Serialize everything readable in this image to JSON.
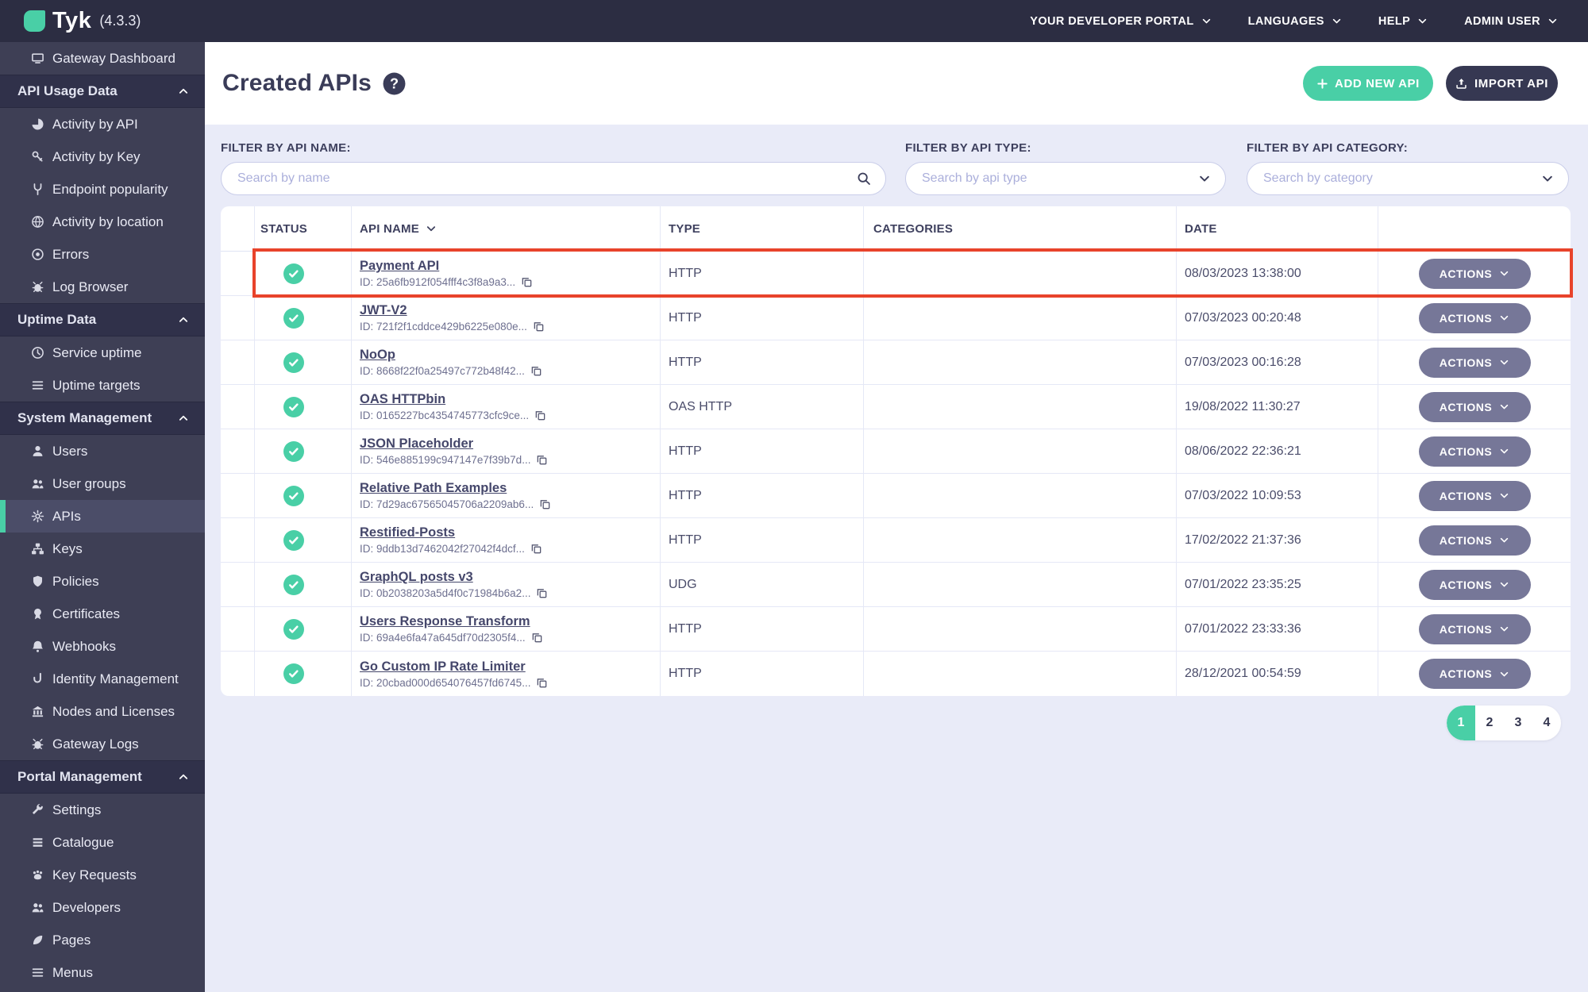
{
  "topbar": {
    "brand": "Tyk",
    "version": "(4.3.3)",
    "menu": [
      {
        "label": "YOUR DEVELOPER PORTAL"
      },
      {
        "label": "LANGUAGES"
      },
      {
        "label": "HELP"
      },
      {
        "label": "ADMIN USER"
      }
    ]
  },
  "sidebar": {
    "items": [
      {
        "type": "item",
        "icon": "monitor",
        "label": "Gateway Dashboard"
      },
      {
        "type": "section",
        "label": "API Usage Data"
      },
      {
        "type": "item",
        "icon": "chart-pie",
        "label": "Activity by API"
      },
      {
        "type": "item",
        "icon": "key",
        "label": "Activity by Key"
      },
      {
        "type": "item",
        "icon": "fork",
        "label": "Endpoint popularity"
      },
      {
        "type": "item",
        "icon": "globe",
        "label": "Activity by location"
      },
      {
        "type": "item",
        "icon": "target",
        "label": "Errors"
      },
      {
        "type": "item",
        "icon": "bug",
        "label": "Log Browser"
      },
      {
        "type": "section",
        "label": "Uptime Data"
      },
      {
        "type": "item",
        "icon": "clock",
        "label": "Service uptime"
      },
      {
        "type": "item",
        "icon": "list",
        "label": "Uptime targets"
      },
      {
        "type": "section",
        "label": "System Management"
      },
      {
        "type": "item",
        "icon": "user",
        "label": "Users"
      },
      {
        "type": "item",
        "icon": "users",
        "label": "User groups"
      },
      {
        "type": "item",
        "icon": "gears",
        "label": "APIs",
        "active": true
      },
      {
        "type": "item",
        "icon": "sitemap",
        "label": "Keys"
      },
      {
        "type": "item",
        "icon": "shield",
        "label": "Policies"
      },
      {
        "type": "item",
        "icon": "badge",
        "label": "Certificates"
      },
      {
        "type": "item",
        "icon": "bell",
        "label": "Webhooks"
      },
      {
        "type": "item",
        "icon": "hook",
        "label": "Identity Management"
      },
      {
        "type": "item",
        "icon": "bank",
        "label": "Nodes and Licenses"
      },
      {
        "type": "item",
        "icon": "bug",
        "label": "Gateway Logs"
      },
      {
        "type": "section",
        "label": "Portal Management"
      },
      {
        "type": "item",
        "icon": "wrench",
        "label": "Settings"
      },
      {
        "type": "item",
        "icon": "rows",
        "label": "Catalogue"
      },
      {
        "type": "item",
        "icon": "paw",
        "label": "Key Requests"
      },
      {
        "type": "item",
        "icon": "users",
        "label": "Developers"
      },
      {
        "type": "item",
        "icon": "leaf",
        "label": "Pages"
      },
      {
        "type": "item",
        "icon": "menu",
        "label": "Menus"
      }
    ]
  },
  "page": {
    "title": "Created APIs",
    "add_button": "ADD NEW API",
    "import_button": "IMPORT API"
  },
  "filters": {
    "name": {
      "label": "FILTER BY API NAME:",
      "placeholder": "Search by name"
    },
    "type": {
      "label": "FILTER BY API TYPE:",
      "placeholder": "Search by api type"
    },
    "category": {
      "label": "FILTER BY API CATEGORY:",
      "placeholder": "Search by category"
    }
  },
  "table": {
    "headers": {
      "status": "STATUS",
      "name": "API NAME",
      "type": "TYPE",
      "categories": "CATEGORIES",
      "date": "DATE"
    },
    "actions_label": "ACTIONS",
    "rows": [
      {
        "status": "active",
        "name": "Payment API",
        "id": "ID: 25a6fb912f054fff4c3f8a9a3...",
        "type": "HTTP",
        "date": "08/03/2023 13:38:00",
        "highlight": true
      },
      {
        "status": "active",
        "name": "JWT-V2",
        "id": "ID: 721f2f1cddce429b6225e080e...",
        "type": "HTTP",
        "date": "07/03/2023 00:20:48"
      },
      {
        "status": "active",
        "name": "NoOp",
        "id": "ID: 8668f22f0a25497c772b48f42...",
        "type": "HTTP",
        "date": "07/03/2023 00:16:28"
      },
      {
        "status": "active",
        "name": "OAS HTTPbin",
        "id": "ID: 0165227bc4354745773cfc9ce...",
        "type": "OAS HTTP",
        "date": "19/08/2022 11:30:27"
      },
      {
        "status": "active",
        "name": "JSON Placeholder",
        "id": "ID: 546e885199c947147e7f39b7d...",
        "type": "HTTP",
        "date": "08/06/2022 22:36:21"
      },
      {
        "status": "active",
        "name": "Relative Path Examples",
        "id": "ID: 7d29ac67565045706a2209ab6...",
        "type": "HTTP",
        "date": "07/03/2022 10:09:53"
      },
      {
        "status": "active",
        "name": "Restified-Posts",
        "id": "ID: 9ddb13d7462042f27042f4dcf...",
        "type": "HTTP",
        "date": "17/02/2022 21:37:36"
      },
      {
        "status": "active",
        "name": "GraphQL posts v3",
        "id": "ID: 0b2038203a5d4f0c71984b6a2...",
        "type": "UDG",
        "date": "07/01/2022 23:35:25"
      },
      {
        "status": "active",
        "name": "Users Response Transform",
        "id": "ID: 69a4e6fa47a645df70d2305f4...",
        "type": "HTTP",
        "date": "07/01/2022 23:33:36"
      },
      {
        "status": "active",
        "name": "Go Custom IP Rate Limiter",
        "id": "ID: 20cbad000d654076457fd6745...",
        "type": "HTTP",
        "date": "28/12/2021 00:54:59"
      }
    ]
  },
  "pagination": {
    "pages": [
      {
        "label": "1",
        "active": true
      },
      {
        "label": "2"
      },
      {
        "label": "3"
      },
      {
        "label": "4"
      }
    ]
  },
  "colors": {
    "accent_teal": "#49CFA6",
    "topbar_navy": "#2C2D42",
    "sidebar_navy": "#3E3F55",
    "import_navy": "#363852",
    "actions_gray": "#767798",
    "highlight_red": "#E8432B",
    "background_lavender": "#E9EBF8",
    "status_green": "#49CFA6"
  }
}
